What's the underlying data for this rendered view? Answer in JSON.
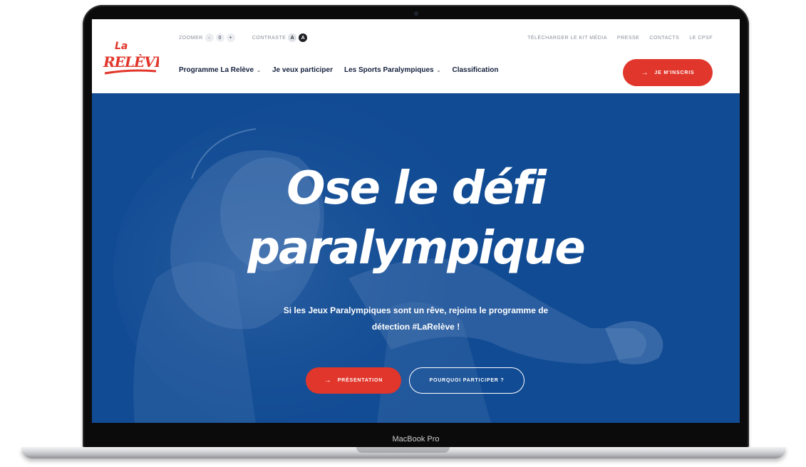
{
  "device": {
    "label": "MacBook Pro"
  },
  "header": {
    "logo_top": "La",
    "logo_main": "RELÈVE",
    "topbar": {
      "zoom_label": "zoomer",
      "zoom_minus": "-",
      "zoom_reset": "0",
      "zoom_plus": "+",
      "contrast_label": "contraste",
      "contrast_light": "A",
      "contrast_dark": "A"
    },
    "toplinks": [
      "Télécharger le kit média",
      "Presse",
      "Contacts",
      "Le CPSF"
    ],
    "nav": [
      {
        "label": "Programme La Relève",
        "has_dropdown": true
      },
      {
        "label": "Je veux participer",
        "has_dropdown": false
      },
      {
        "label": "Les Sports Paralympiques",
        "has_dropdown": true
      },
      {
        "label": "Classification",
        "has_dropdown": false
      }
    ],
    "cta": {
      "label": "Je m'inscris",
      "arrow": "→"
    }
  },
  "hero": {
    "title_line1": "Ose le défi",
    "title_line2": "paralympique",
    "subtitle_line1": "Si les Jeux Paralympiques sont un rêve, rejoins le programme de",
    "subtitle_line2": "détection #LaRelève !",
    "buttons": {
      "primary": "Présentation",
      "secondary": "Pourquoi participer ?",
      "arrow": "→"
    }
  },
  "colors": {
    "brand_blue": "#114b93",
    "accent_red": "#e1362b",
    "text_dark": "#14213d"
  }
}
